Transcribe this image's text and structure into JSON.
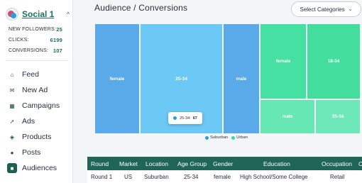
{
  "sidebar": {
    "brand": {
      "name": "Social 1",
      "caret": "^"
    },
    "stats": [
      {
        "label": "NEW FOLLOWERS:",
        "value": "25"
      },
      {
        "label": "CLICKS:",
        "value": "6199"
      },
      {
        "label": "CONVERSIONS:",
        "value": "107"
      }
    ],
    "nav": [
      {
        "label": "Feed",
        "icon": "home-icon",
        "glyph": "⌂"
      },
      {
        "label": "New Ad",
        "icon": "megaphone-icon",
        "glyph": "✉"
      },
      {
        "label": "Campaigns",
        "icon": "table-icon",
        "glyph": "▦"
      },
      {
        "label": "Ads",
        "icon": "cursor-icon",
        "glyph": "➚"
      },
      {
        "label": "Products",
        "icon": "cube-icon",
        "glyph": "◈"
      },
      {
        "label": "Posts",
        "icon": "chat-icon",
        "glyph": "●"
      },
      {
        "label": "Audiences",
        "icon": "people-icon",
        "glyph": "■"
      }
    ],
    "active_nav": "Audiences"
  },
  "main": {
    "title": "Audience / Conversions",
    "select": {
      "label": "Select Categories"
    }
  },
  "chart_data": {
    "type": "treemap",
    "title": "",
    "legend": [
      {
        "name": "Suburban",
        "color": "#2d9cdb"
      },
      {
        "name": "Urban",
        "color": "#3ddc97"
      }
    ],
    "groups": [
      {
        "name": "Suburban",
        "color": "#5dadec",
        "cells": [
          {
            "label": "female",
            "color": "#5aaae9"
          },
          {
            "label": "25-34",
            "color": "#6cc8f5"
          },
          {
            "label": "male",
            "color": "#5aaae9"
          }
        ]
      },
      {
        "name": "Urban",
        "color": "#3ddc97",
        "cells": [
          {
            "label": "female",
            "color": "#47e0a3"
          },
          {
            "label": "18-34",
            "color": "#43dd9e"
          },
          {
            "label": "male",
            "color": "#66e7b4"
          },
          {
            "label": "25-34",
            "color": "#6fe8b9"
          }
        ]
      }
    ],
    "tooltip": {
      "label": "25-34:",
      "value": "67"
    }
  },
  "table": {
    "headers": [
      "Round",
      "Market",
      "Location",
      "Age Group",
      "Gender",
      "Education",
      "Occupation",
      "C"
    ],
    "rows": [
      [
        "Round 1",
        "US",
        "Suburban",
        "25-34",
        "female",
        "High School/Some College",
        "Retail",
        ""
      ]
    ]
  }
}
